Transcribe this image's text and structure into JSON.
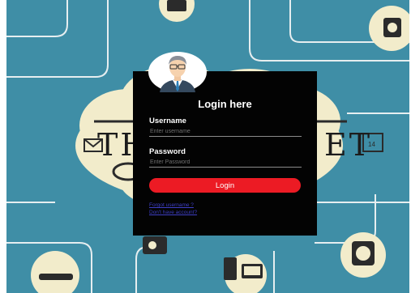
{
  "login": {
    "title": "Login here",
    "username_label": "Username",
    "username_placeholder": "Enter username",
    "username_value": "",
    "password_label": "Password",
    "password_placeholder": "Enter Password",
    "password_value": "",
    "login_button": "Login",
    "forgot_link": "Forgot username ?",
    "signup_link": "Don't have account?"
  },
  "background": {
    "text_left": "TH",
    "text_right": "ET",
    "calendar_text": "14",
    "color": "#3f8ea6"
  },
  "colors": {
    "panel": "#030303",
    "button": "#ec1b24",
    "link": "#3d3ec5"
  },
  "icons": {
    "avatar": "user-avatar-icon"
  }
}
